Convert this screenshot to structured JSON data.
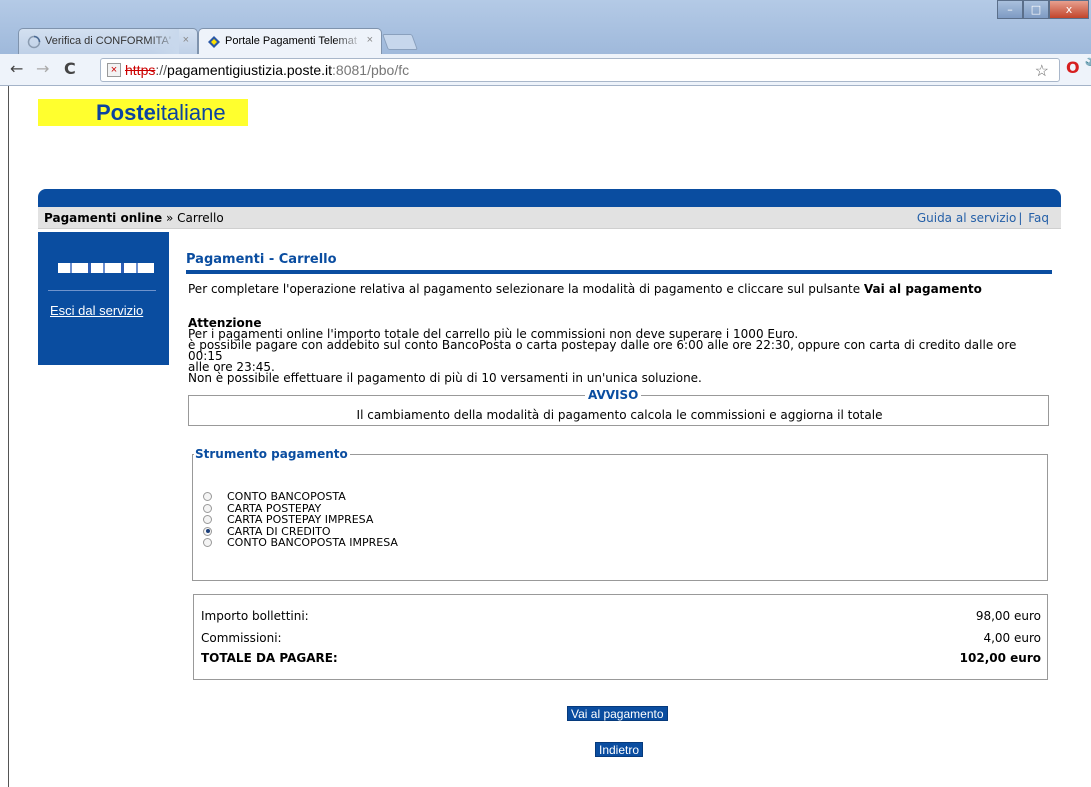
{
  "browser": {
    "tabs": [
      {
        "label": "Verifica di CONFORMITA'",
        "active": false
      },
      {
        "label": "Portale Pagamenti Telemat",
        "active": true
      }
    ],
    "url": {
      "scheme": "https",
      "rest_scheme": "://",
      "host": "pagamentigiustizia.poste.it",
      "path": ":8081/pbo/fc"
    },
    "window_buttons": [
      "–",
      "□",
      "x"
    ]
  },
  "logo": {
    "bold": "Poste",
    "normal": "italiane"
  },
  "breadcrumb": {
    "root": "Pagamenti online",
    "sep": " » ",
    "current": "Carrello"
  },
  "top_links": {
    "guide": "Guida al servizio",
    "sep": "|",
    "faq": "Faq"
  },
  "sidebar": {
    "exit_link": "Esci dal servizio"
  },
  "page": {
    "title": "Pagamenti - Carrello",
    "intro_text": "Per completare l'operazione relativa al pagamento selezionare la modalità di pagamento e cliccare sul pulsante ",
    "intro_bold": "Vai al pagamento",
    "attention_title": "Attenzione",
    "attention_line1": "Per i pagamenti online l'importo totale del carrello più le commissioni non deve superare i 1000 Euro.",
    "attention_line2": "è possibile pagare con addebito sul conto BancoPosta o carta postepay dalle ore 6:00 alle ore 22:30, oppure con carta di credito dalle ore 00:15",
    "attention_line3": "alle ore 23:45.",
    "attention_line4": "Non è possibile effettuare il pagamento di più di 10 versamenti in un'unica soluzione.",
    "notice_title": "AVVISO",
    "notice_text": "Il cambiamento della modalità di pagamento calcola le commissioni e aggiorna il totale",
    "instrument_title": "Strumento pagamento",
    "options": [
      {
        "label": "CONTO BANCOPOSTA",
        "selected": false
      },
      {
        "label": "CARTA POSTEPAY",
        "selected": false
      },
      {
        "label": "CARTA POSTEPAY IMPRESA",
        "selected": false
      },
      {
        "label": "CARTA DI CREDITO",
        "selected": true
      },
      {
        "label": "CONTO BANCOPOSTA IMPRESA",
        "selected": false
      }
    ],
    "totals": {
      "amount_label": "Importo bollettini:",
      "amount_value": "98,00 euro",
      "fees_label": "Commissioni:",
      "fees_value": "4,00 euro",
      "total_label": "TOTALE DA PAGARE:",
      "total_value": "102,00 euro"
    },
    "pay_button": "Vai al pagamento",
    "back_button": "Indietro"
  },
  "colors": {
    "brand_blue": "#0a4da0",
    "logo_yellow": "#ffff2e"
  }
}
